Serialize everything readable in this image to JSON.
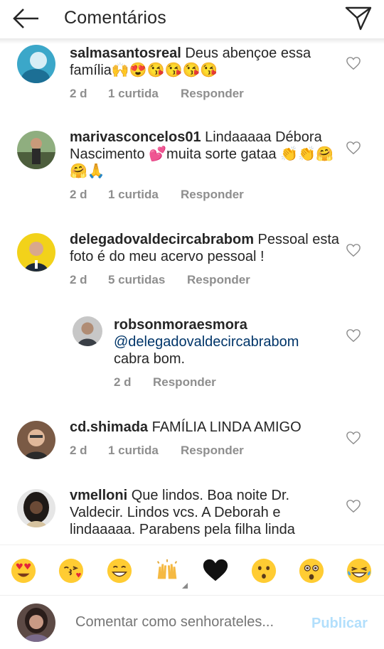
{
  "header": {
    "title": "Comentários",
    "back_icon": "arrow-left-icon",
    "direct_icon": "paper-plane-icon"
  },
  "comments": [
    {
      "username": "salmasantosreal",
      "text": " Deus abençoe essa família🙌😍😘😘😘😘",
      "time": "2 d",
      "likes": "1 curtida",
      "reply": "Responder"
    },
    {
      "username": "marivasconcelos01",
      "text": " Lindaaaaa Débora Nascimento 💕muita sorte gataa 👏👏🤗🤗🙏",
      "time": "2 d",
      "likes": "1 curtida",
      "reply": "Responder"
    },
    {
      "username": "delegadovaldecircabrabom",
      "text": " Pessoal esta  foto é do meu acervo pessoal !",
      "time": "2 d",
      "likes": "5 curtidas",
      "reply": "Responder"
    },
    {
      "username": "robsonmoraesmora",
      "mention": "@delegadovaldecircabrabom",
      "text": "cabra bom.",
      "time": "2 d",
      "reply": "Responder"
    },
    {
      "username": "cd.shimada",
      "text": " FAMÍLIA LINDA AMIGO",
      "time": "2 d",
      "likes": "1 curtida",
      "reply": "Responder"
    },
    {
      "username": "vmelloni",
      "text": " Que lindos. Boa noite Dr. Valdecir. Lindos vcs. A Deborah e lindaaaaa. Parabens pela filha linda"
    }
  ],
  "emoji_bar": [
    "heart-eyes-emoji",
    "kissing-heart-emoji",
    "grin-emoji",
    "raising-hands-emoji",
    "black-heart-emoji",
    "hushed-emoji",
    "astonished-emoji",
    "joy-emoji"
  ],
  "composer": {
    "placeholder": "Comentar como senhorateles...",
    "publish_label": "Publicar"
  },
  "colors": {
    "text": "#262626",
    "meta": "#8e8e8e",
    "mention": "#003569",
    "publish_disabled": "#b2dffc"
  }
}
